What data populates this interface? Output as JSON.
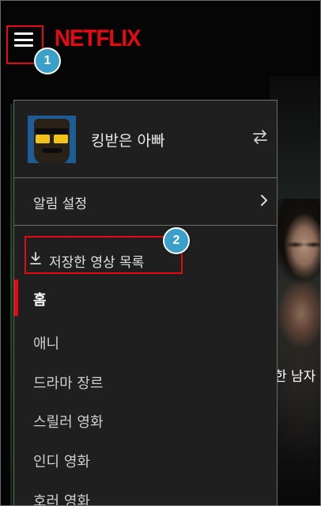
{
  "header": {
    "logo": "NETFLIX",
    "menu_icon": "hamburger-menu-icon"
  },
  "annotations": {
    "badge_1": "1",
    "badge_2": "2"
  },
  "background": {
    "poster_text": "한 남자"
  },
  "drawer": {
    "profile": {
      "name": "킹받은 아빠",
      "switch_icon": "switch-profile-icon"
    },
    "notifications_label": "알림 설정",
    "downloads_label": "저장한 영상 목록",
    "menu": [
      {
        "label": "홈",
        "active": true
      },
      {
        "label": "애니"
      },
      {
        "label": "드라마 장르"
      },
      {
        "label": "스릴러 영화"
      },
      {
        "label": "인디 영화"
      },
      {
        "label": "호러 영화"
      }
    ]
  },
  "colors": {
    "accent": "#e50914",
    "badge": "#3a9fc9",
    "drawer_bg": "#1f1f1f"
  }
}
